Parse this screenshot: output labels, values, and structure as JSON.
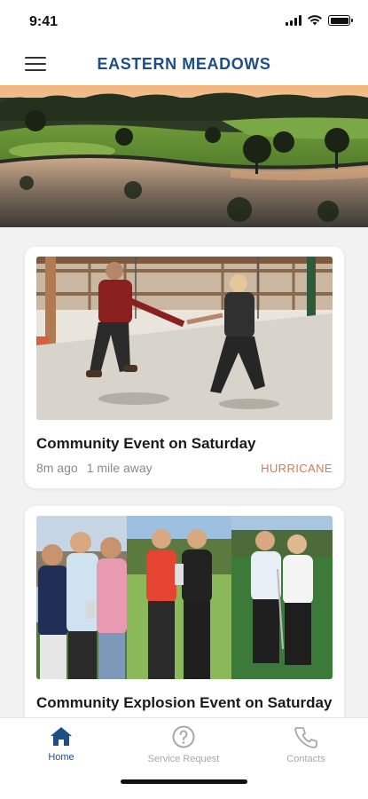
{
  "status_bar": {
    "time": "9:41",
    "icons": [
      "cellular-signal-icon",
      "wifi-icon",
      "battery-icon"
    ]
  },
  "header": {
    "title": "EASTERN MEADOWS",
    "menu_icon": "hamburger-menu-icon"
  },
  "colors": {
    "brand": "#1d4e86",
    "tag": "#e8734a",
    "muted": "#8a8a8a",
    "inactive_nav": "#a8a8a8"
  },
  "feed": [
    {
      "title": "Community Event on Saturday",
      "time_ago": "8m ago",
      "distance": "1 mile away",
      "tag": "HURRICANE",
      "image": "photo of two people swinging on a porch swing"
    },
    {
      "title": "Community Explosion Event on Saturday",
      "image": "collage of golfers posing with trophies"
    }
  ],
  "bottom_nav": [
    {
      "label": "Home",
      "icon": "home-icon",
      "active": true
    },
    {
      "label": "Service Request",
      "icon": "question-circle-icon",
      "active": false
    },
    {
      "label": "Contacts",
      "icon": "phone-icon",
      "active": false
    }
  ]
}
